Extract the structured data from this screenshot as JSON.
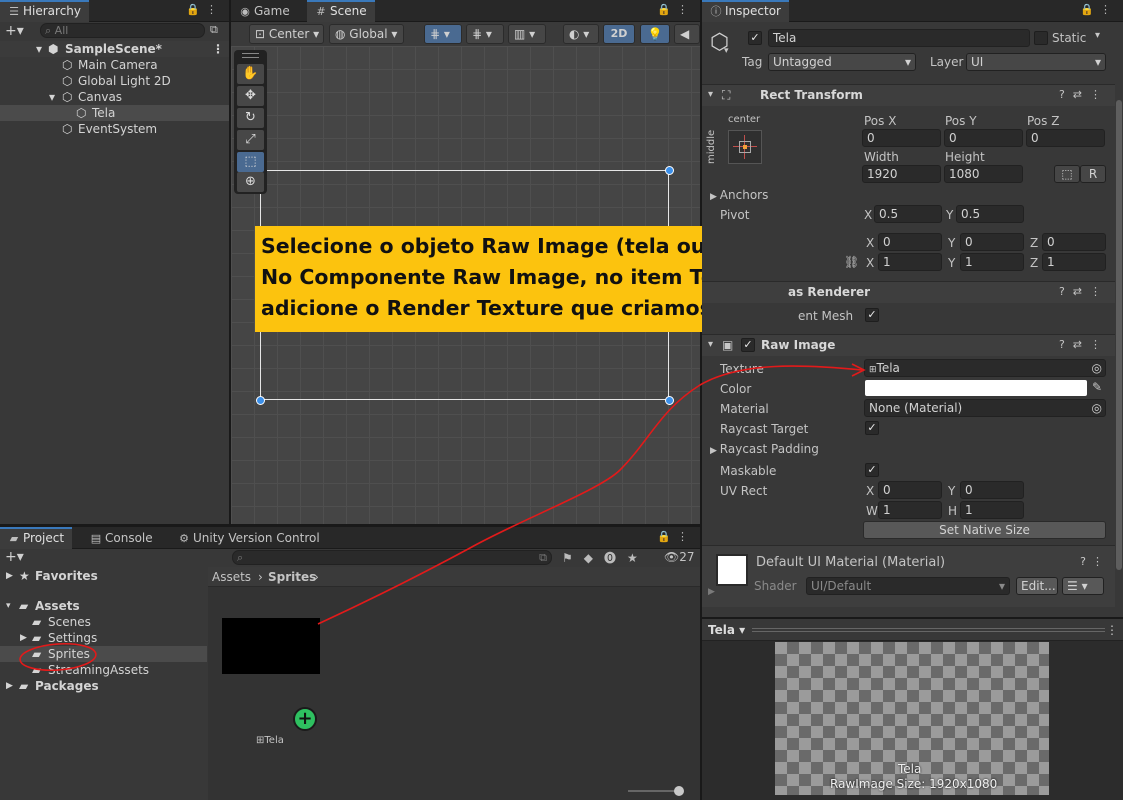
{
  "hierarchy": {
    "tab": "Hierarchy",
    "search_placeholder": "All",
    "items": [
      {
        "label": "SampleScene*"
      },
      {
        "label": "Main Camera"
      },
      {
        "label": "Global Light 2D"
      },
      {
        "label": "Canvas"
      },
      {
        "label": "Tela"
      },
      {
        "label": "EventSystem"
      }
    ]
  },
  "scene": {
    "tabs": [
      {
        "label": "Game"
      },
      {
        "label": "Scene"
      }
    ],
    "toolbar": {
      "pivot": "Center",
      "space": "Global",
      "mode2d": "2D"
    }
  },
  "callout": {
    "line1": "Selecione o objeto Raw Image (tela ou screen).",
    "line2": "No Componente Raw Image, no item Texture",
    "line3": "adicione o Render Texture que criamos."
  },
  "inspector": {
    "tab": "Inspector",
    "object_name": "Tela",
    "static_label": "Static",
    "tag_label": "Tag",
    "tag_value": "Untagged",
    "layer_label": "Layer",
    "layer_value": "UI",
    "rect_transform": {
      "title": "Rect Transform",
      "anchor_h": "center",
      "anchor_v": "middle",
      "pos_x_label": "Pos X",
      "pos_x": "0",
      "pos_y_label": "Pos Y",
      "pos_y": "0",
      "pos_z_label": "Pos Z",
      "pos_z": "0",
      "width_label": "Width",
      "width": "1920",
      "height_label": "Height",
      "height": "1080",
      "r_button": "R",
      "anchors_label": "Anchors",
      "pivot_label": "Pivot",
      "pivot_x": "0.5",
      "pivot_y": "0.5",
      "rot_x": "0",
      "rot_y": "0",
      "rot_z": "0",
      "scale_x": "1",
      "scale_y": "1",
      "scale_z": "1",
      "x": "X",
      "y": "Y",
      "z": "Z"
    },
    "canvas_renderer": {
      "title": "as Renderer",
      "cull_label": "ent Mesh"
    },
    "raw_image": {
      "title": "Raw Image",
      "texture_label": "Texture",
      "texture_value": "Tela",
      "color_label": "Color",
      "material_label": "Material",
      "material_value": "None (Material)",
      "raycast_target_label": "Raycast Target",
      "raycast_padding_label": "Raycast Padding",
      "maskable_label": "Maskable",
      "uvrect_label": "UV Rect",
      "uv_x_label": "X",
      "uv_x": "0",
      "uv_y_label": "Y",
      "uv_y": "0",
      "uv_w_label": "W",
      "uv_w": "1",
      "uv_h_label": "H",
      "uv_h": "1",
      "native_size_button": "Set Native Size"
    },
    "material_section": {
      "title": "Default UI Material (Material)",
      "shader_label": "Shader",
      "shader_value": "UI/Default",
      "edit_button": "Edit..."
    },
    "preview": {
      "dropdown": "Tela",
      "caption_name": "Tela",
      "caption_size": "RawImage Size: 1920x1080"
    }
  },
  "project": {
    "tabs": [
      {
        "label": "Project"
      },
      {
        "label": "Console"
      },
      {
        "label": "Unity Version Control"
      }
    ],
    "count": "27",
    "tree": [
      {
        "label": "Favorites"
      },
      {
        "label": "Assets"
      },
      {
        "label": "Scenes"
      },
      {
        "label": "Settings"
      },
      {
        "label": "Sprites"
      },
      {
        "label": "StreamingAssets"
      },
      {
        "label": "Packages"
      }
    ],
    "breadcrumb": [
      {
        "label": "Assets"
      },
      {
        "label": "Sprites"
      }
    ],
    "asset": {
      "label": "Tela"
    }
  },
  "colors": {
    "annotation_red": "#e21a1a",
    "callout_yellow": "#fcc30e",
    "accent_blue": "#3a79bb"
  }
}
